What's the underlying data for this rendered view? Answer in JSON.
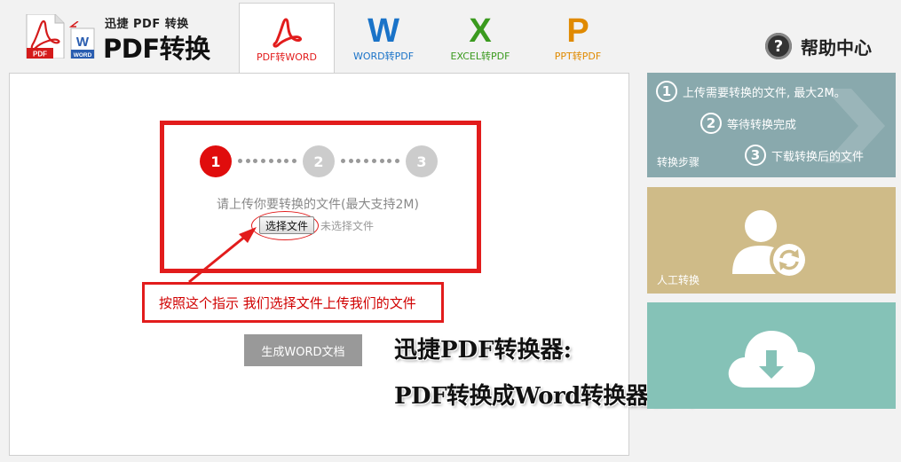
{
  "header": {
    "logo_subtitle": "迅捷 PDF 转换",
    "logo_title": "PDF转换器",
    "logo_pdf_badge": "PDF",
    "logo_word_badge": "WORD",
    "tabs": [
      {
        "label": "PDF转WORD",
        "icon": "pdf-acrobat-icon",
        "color": "#e21c1c",
        "active": true
      },
      {
        "label": "WORD转PDF",
        "icon_text": "W",
        "icon": "word-icon",
        "color": "#1a73c8",
        "active": false
      },
      {
        "label": "EXCEL转PDF",
        "icon_text": "X",
        "icon": "excel-icon",
        "color": "#3a9a1e",
        "active": false
      },
      {
        "label": "PPT转PDF",
        "icon_text": "P",
        "icon": "ppt-icon",
        "color": "#e08a00",
        "active": false
      }
    ],
    "help_label": "帮助中心",
    "help_icon_text": "?"
  },
  "main": {
    "steps": [
      "1",
      "2",
      "3"
    ],
    "step_active_color": "#e00d0d",
    "step_inactive_color": "#cccccc",
    "upload_hint": "请上传你要转换的文件(最大支持2M)",
    "choose_file_label": "选择文件",
    "no_file_label": "未选择文件",
    "annotation": "按照这个指示 我们选择文件上传我们的文件",
    "generate_label": "生成WORD文档",
    "overlay_line1": "迅捷PDF转换器:",
    "overlay_line2": "PDF转换成Word转换器在线"
  },
  "sidebar": {
    "steps_panel": {
      "items": [
        {
          "num": "1",
          "text": "上传需要转换的文件, 最大2M。"
        },
        {
          "num": "2",
          "text": "等待转换完成"
        },
        {
          "num": "3",
          "text": "下载转换后的文件"
        }
      ],
      "label": "转换步骤"
    },
    "manual_panel": {
      "label": "人工转换",
      "icon": "person-refresh-icon"
    },
    "download_panel": {
      "icon": "cloud-download-icon"
    }
  }
}
